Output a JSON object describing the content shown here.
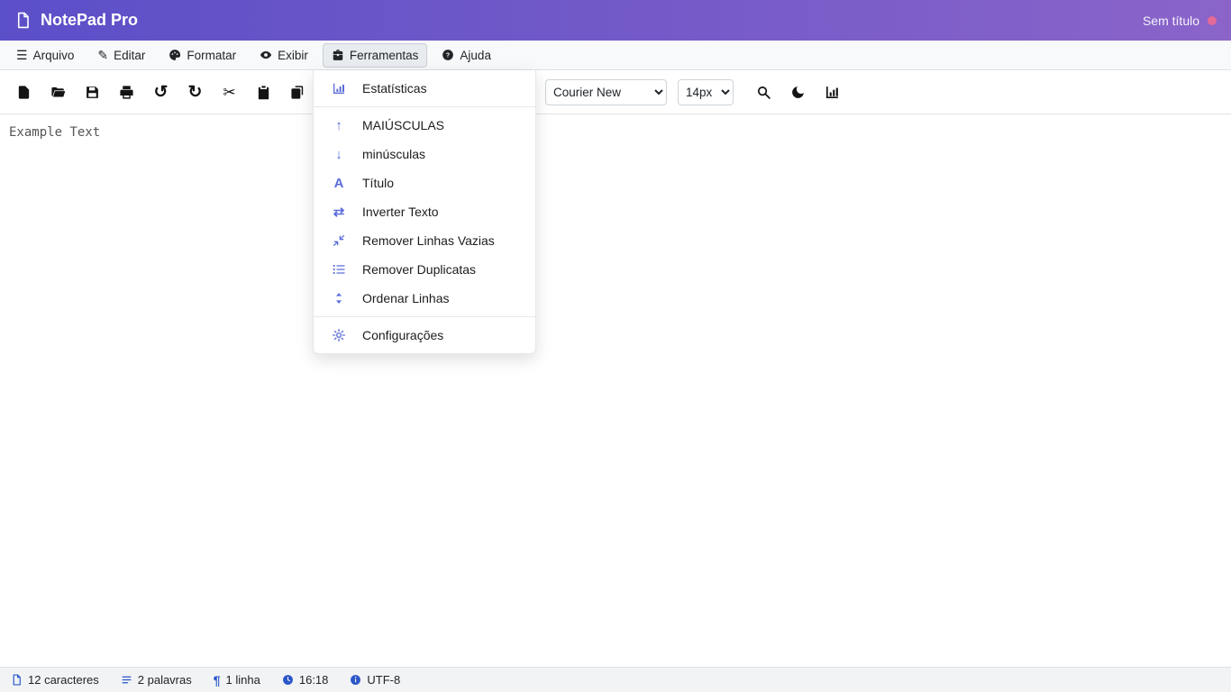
{
  "theme": {
    "header_grad_start": "#5b4fc8",
    "header_grad_end": "#8a64c9",
    "menu_icon_accent": "#5b6dd8",
    "status_icon": "#2b57c8",
    "unsaved_dot": "#e56a97"
  },
  "header": {
    "app_title": "NotePad Pro",
    "document_name": "Sem título"
  },
  "menubar": {
    "items": [
      {
        "label": "Arquivo"
      },
      {
        "label": "Editar"
      },
      {
        "label": "Formatar"
      },
      {
        "label": "Exibir"
      },
      {
        "label": "Ferramentas",
        "active": true
      },
      {
        "label": "Ajuda"
      }
    ]
  },
  "toolbar": {
    "font_family_value": "Courier New",
    "font_size_value": "14px"
  },
  "tools_menu": {
    "items": [
      {
        "label": "Estatísticas"
      },
      {
        "label": "MAIÚSCULAS"
      },
      {
        "label": "minúsculas"
      },
      {
        "label": "Título"
      },
      {
        "label": "Inverter Texto"
      },
      {
        "label": "Remover Linhas Vazias"
      },
      {
        "label": "Remover Duplicatas"
      },
      {
        "label": "Ordenar Linhas"
      },
      {
        "label": "Configurações"
      }
    ]
  },
  "editor": {
    "content": "Example Text"
  },
  "statusbar": {
    "characters": "12 caracteres",
    "words": "2 palavras",
    "lines": "1 linha",
    "time": "16:18",
    "encoding": "UTF-8"
  },
  "icons": {
    "bars": "☰",
    "pen": "✎",
    "undo": "↺",
    "redo": "↻",
    "cut": "✂",
    "arrow_up": "↑",
    "arrow_down": "↓",
    "swap": "⇄",
    "title_letter": "A",
    "pilcrow": "¶"
  }
}
